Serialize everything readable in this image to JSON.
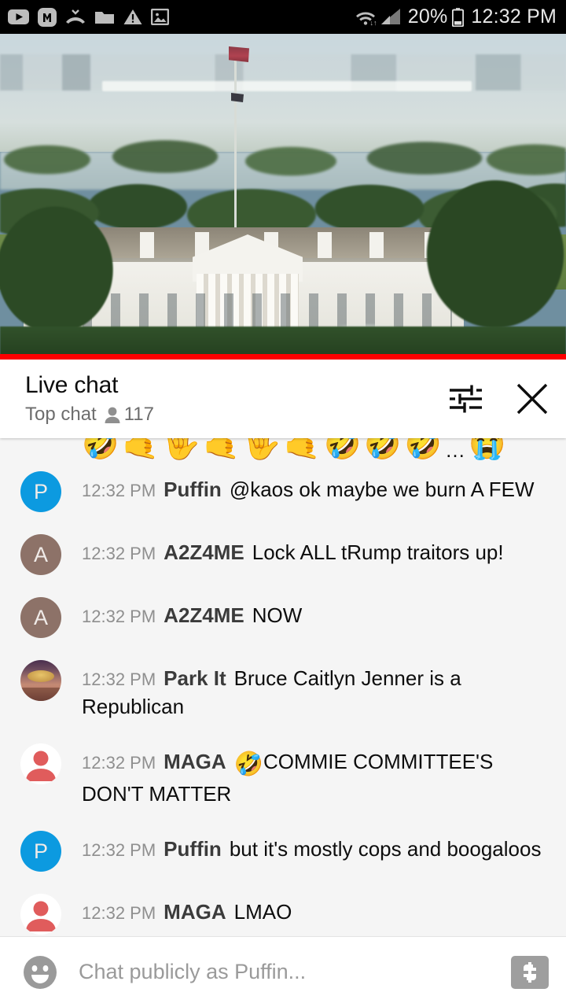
{
  "status_bar": {
    "icons": [
      "youtube-icon",
      "m-app-icon",
      "missed-call-icon",
      "folder-icon",
      "warning-triangle-icon",
      "image-icon"
    ],
    "wifi_icon": "wifi-icon",
    "signal_icon": "cell-signal-icon",
    "battery_percent": "20%",
    "battery_icon": "battery-icon",
    "time": "12:32 PM"
  },
  "video": {
    "name": "white-house-live-stream",
    "progress_percent": 100,
    "progress_color": "#ff0000"
  },
  "chat_header": {
    "title": "Live chat",
    "mode": "Top chat",
    "viewer_icon": "person-icon",
    "viewer_count": "117",
    "settings_icon": "chat-settings-icon",
    "close_icon": "close-icon"
  },
  "emoji_row": {
    "emojis": [
      "🤣",
      "🤙",
      "🤟",
      "🤙",
      "🤟",
      "🤙",
      "🤣",
      "🤣",
      "🤣"
    ],
    "overflow": "…",
    "trailing_emoji": "😭"
  },
  "messages": [
    {
      "time": "12:32 PM",
      "author": "Puffin",
      "text": "@kaos ok maybe we burn A FEW",
      "avatar_type": "letter-blue",
      "avatar_letter": "P",
      "avatar_color": "#0c9ae0"
    },
    {
      "time": "12:32 PM",
      "author": "A2Z4ME",
      "text": "Lock ALL tRump traitors up!",
      "avatar_type": "letter-brown",
      "avatar_letter": "A",
      "avatar_color": "#8d7268"
    },
    {
      "time": "12:32 PM",
      "author": "A2Z4ME",
      "text": "NOW",
      "avatar_type": "letter-brown",
      "avatar_letter": "A",
      "avatar_color": "#8d7268"
    },
    {
      "time": "12:32 PM",
      "author": "Park It",
      "text": "Bruce Caitlyn Jenner is a Republican",
      "avatar_type": "photo",
      "avatar_letter": "",
      "avatar_color": "#7d4f46"
    },
    {
      "time": "12:32 PM",
      "author": "MAGA",
      "emoji": "🤣",
      "text": "COMMIE COMMITTEE'S DON'T MATTER",
      "avatar_type": "default",
      "avatar_letter": "",
      "avatar_color": "#e05c5c"
    },
    {
      "time": "12:32 PM",
      "author": "Puffin",
      "text": "but it's mostly cops and boogaloos",
      "avatar_type": "letter-blue",
      "avatar_letter": "P",
      "avatar_color": "#0c9ae0"
    },
    {
      "time": "12:32 PM",
      "author": "MAGA",
      "text": "LMAO",
      "avatar_type": "default",
      "avatar_letter": "",
      "avatar_color": "#e05c5c"
    }
  ],
  "input_bar": {
    "emoji_icon": "emoji-smiley-icon",
    "placeholder": "Chat publicly as Puffin...",
    "value": "",
    "superchat_icon": "dollar-sign-icon"
  }
}
